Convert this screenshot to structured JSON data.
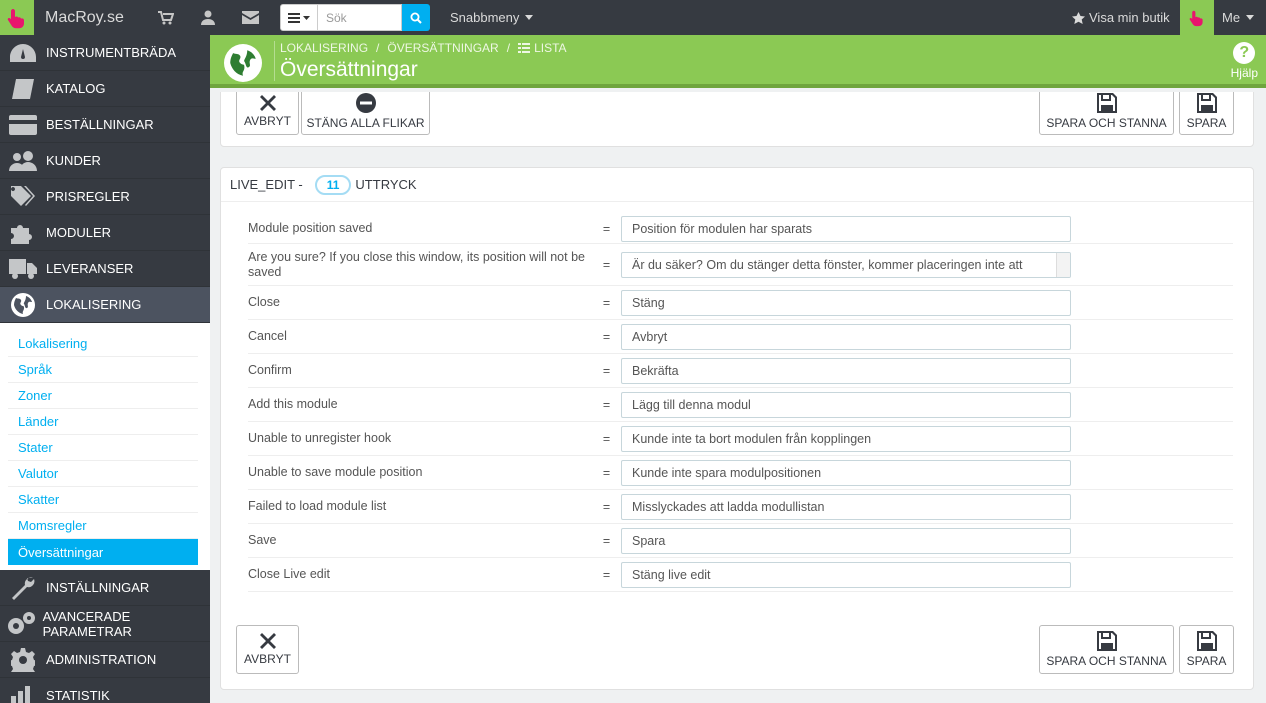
{
  "header": {
    "brand": "MacRoy.se",
    "search_placeholder": "Sök",
    "quick_menu": "Snabbmeny",
    "view_shop": "Visa min butik",
    "me": "Me"
  },
  "sidebar": {
    "items_top": [
      {
        "label": "INSTRUMENTBRÄDA",
        "icon": "dashboard-icon"
      },
      {
        "label": "KATALOG",
        "icon": "book-icon"
      },
      {
        "label": "BESTÄLLNINGAR",
        "icon": "credit-card-icon"
      },
      {
        "label": "KUNDER",
        "icon": "users-icon"
      },
      {
        "label": "PRISREGLER",
        "icon": "tags-icon"
      },
      {
        "label": "MODULER",
        "icon": "puzzle-icon"
      },
      {
        "label": "LEVERANSER",
        "icon": "truck-icon"
      },
      {
        "label": "LOKALISERING",
        "icon": "globe-icon"
      }
    ],
    "submenu": [
      "Lokalisering",
      "Språk",
      "Zoner",
      "Länder",
      "Stater",
      "Valutor",
      "Skatter",
      "Momsregler",
      "Översättningar"
    ],
    "items_bottom": [
      {
        "label": "INSTÄLLNINGAR",
        "icon": "wrench-icon"
      },
      {
        "label": "AVANCERADE PARAMETRAR",
        "icon": "cogs-icon"
      },
      {
        "label": "ADMINISTRATION",
        "icon": "cog-icon"
      },
      {
        "label": "STATISTIK",
        "icon": "chart-icon"
      }
    ]
  },
  "pagehead": {
    "breadcrumb": [
      "LOKALISERING",
      "ÖVERSÄTTNINGAR",
      "LISTA"
    ],
    "title": "Översättningar",
    "help": "Hjälp"
  },
  "toolbar": {
    "cancel": "AVBRYT",
    "close_tabs": "STÄNG ALLA FLIKAR",
    "save_stay": "SPARA OCH STANNA",
    "save": "SPARA"
  },
  "panel": {
    "key": "LIVE_EDIT -",
    "count": "11",
    "suffix": "UTTRYCK"
  },
  "rows": [
    {
      "src": "Module position saved",
      "val": "Position för modulen har sparats"
    },
    {
      "src": "Are you sure? If you close this window, its position will not be saved",
      "val": "Är du säker? Om du stänger detta fönster, kommer placeringen inte att"
    },
    {
      "src": "Close",
      "val": "Stäng"
    },
    {
      "src": "Cancel",
      "val": "Avbryt"
    },
    {
      "src": "Confirm",
      "val": "Bekräfta"
    },
    {
      "src": "Add this module",
      "val": "Lägg till denna modul"
    },
    {
      "src": "Unable to unregister hook",
      "val": "Kunde inte ta bort modulen från kopplingen"
    },
    {
      "src": "Unable to save module position",
      "val": "Kunde inte spara modulpositionen"
    },
    {
      "src": "Failed to load module list",
      "val": "Misslyckades att ladda modullistan"
    },
    {
      "src": "Save",
      "val": "Spara"
    },
    {
      "src": "Close Live edit",
      "val": "Stäng live edit"
    }
  ],
  "equals": "="
}
